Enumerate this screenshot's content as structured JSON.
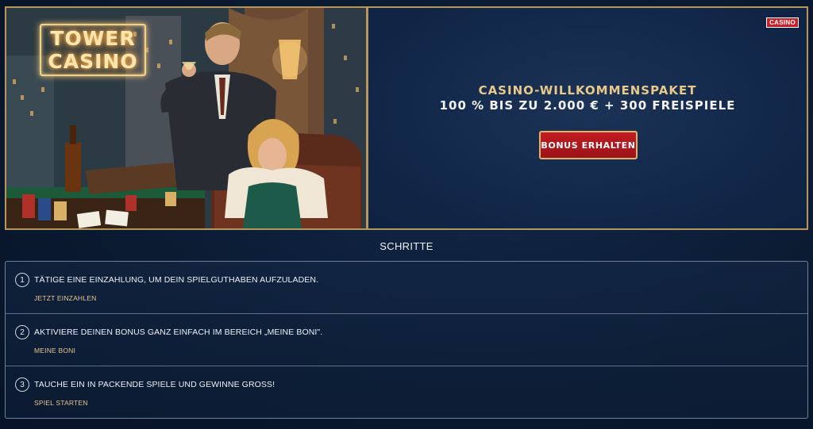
{
  "hero": {
    "logo_line1": "TOWER",
    "logo_line2": "CASINO",
    "tag": "CASINO",
    "offer_title": "CASINO-WILLKOMMENSPAKET",
    "offer_sub": "100 % BIS ZU 2.000 € + 300 FREISPIELE",
    "cta_label": "BONUS ERHALTEN"
  },
  "steps": {
    "heading": "SCHRITTE",
    "items": [
      {
        "num": "1",
        "text": "TÄTIGE EINE EINZAHLUNG, UM DEIN SPIELGUTHABEN AUFZULADEN.",
        "link": "JETZT EINZAHLEN"
      },
      {
        "num": "2",
        "text": "AKTIVIERE DEINEN BONUS GANZ EINFACH IM BEREICH „MEINE BONI\".",
        "link": "MEINE BONI"
      },
      {
        "num": "3",
        "text": "TAUCHE EIN IN PACKENDE SPIELE UND GEWINNE GROSS!",
        "link": "SPIEL STARTEN"
      }
    ]
  },
  "colors": {
    "gold": "#b8955a",
    "accent_red": "#c21d22",
    "link_gold": "#e7c88c",
    "background": "#0a1a30"
  }
}
